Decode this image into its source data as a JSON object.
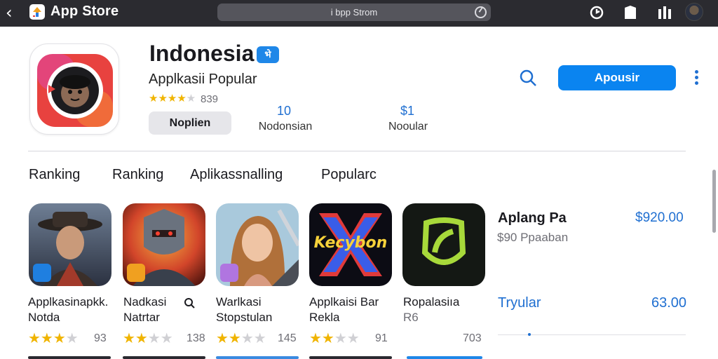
{
  "topbar": {
    "app_title": "App Store",
    "address": "i bpp Strom"
  },
  "app": {
    "name": "Indonesia",
    "badge": "भे",
    "subtitle": "Applkasii Popular",
    "rating": 4,
    "rating_count": "839",
    "secondary_button": "Noplien",
    "stats": [
      {
        "value": "10",
        "label": "Nodonsian"
      },
      {
        "value": "$1",
        "label": "Nooular"
      }
    ],
    "primary_button": "Apousir"
  },
  "tabs": [
    "Ranking",
    "Ranking",
    "Aplikassnalling",
    "Popularc"
  ],
  "tiles": [
    {
      "line1": "Applkasinapkk.",
      "line2": "Notda",
      "rating": 3,
      "count": "93"
    },
    {
      "line1": "Nadkasi",
      "line2": "Natrtar",
      "rating": 2,
      "count": "138"
    },
    {
      "line1": "Warlkasi",
      "line2": "Stopstulan",
      "rating": 2,
      "count": "145"
    },
    {
      "line1": "Applkaisi Bar",
      "line2": "Rekla",
      "rating": 2,
      "count": "91"
    },
    {
      "line1": "Ropalasiıa",
      "line2": "R6",
      "rating": 0,
      "count": "703"
    }
  ],
  "tile_art": {
    "tile3_text": "Kecybon"
  },
  "right_panel": {
    "title": "Aplang Pa",
    "subtitle": "$90 Ppaaban",
    "price": "$920.00",
    "row2_label": "Tryular",
    "row2_value": "63.00"
  },
  "colors": {
    "accent": "#0a84f0",
    "link": "#1f6fd1",
    "star": "#f0b400",
    "topbar": "#2b2b30"
  }
}
